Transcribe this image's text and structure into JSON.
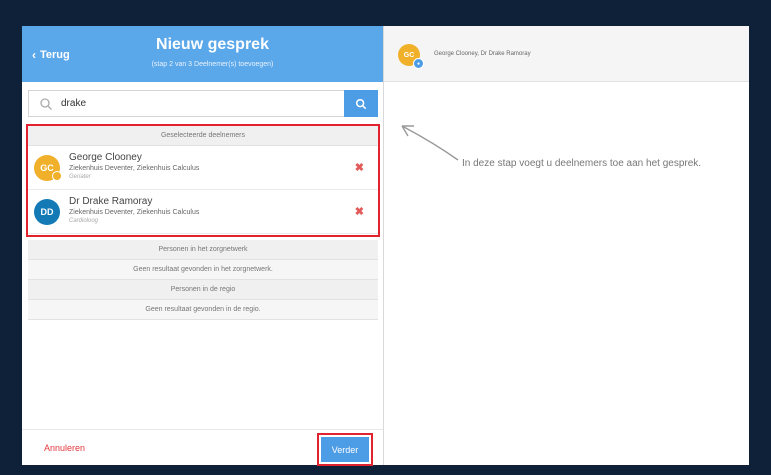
{
  "header": {
    "back_label": "Terug",
    "title": "Nieuw gesprek",
    "subtitle": "(stap 2 van 3 Deelnemer(s) toevoegen)"
  },
  "search": {
    "value": "drake"
  },
  "selected": {
    "heading": "Geselecteerde deelnemers",
    "people": [
      {
        "initials": "GC",
        "name": "George Clooney",
        "org": "Ziekenhuis Deventer, Ziekenhuis Calculus",
        "role": "Geriater"
      },
      {
        "initials": "DD",
        "name": "Dr Drake Ramoray",
        "org": "Ziekenhuis Deventer, Ziekenhuis Calculus",
        "role": "Cardioloog"
      }
    ]
  },
  "sections": [
    {
      "heading": "Personen in het zorgnetwerk",
      "empty": "Geen resultaat gevonden in het zorgnetwerk."
    },
    {
      "heading": "Personen in de regio",
      "empty": "Geen resultaat gevonden in de regio."
    }
  ],
  "footer": {
    "cancel_label": "Annuleren",
    "next_label": "Verder"
  },
  "conversation": {
    "avatar_initials": "GC",
    "participants_label": "George Clooney, Dr Drake Ramoray",
    "hint": "In deze stap voegt u deelnemers toe aan het gesprek."
  },
  "colors": {
    "header_blue": "#5aa7ea",
    "button_blue": "#4c9ce6",
    "highlight_red": "#e0232e",
    "avatar_gc": "#f0b02a",
    "avatar_dd": "#137ab6"
  }
}
